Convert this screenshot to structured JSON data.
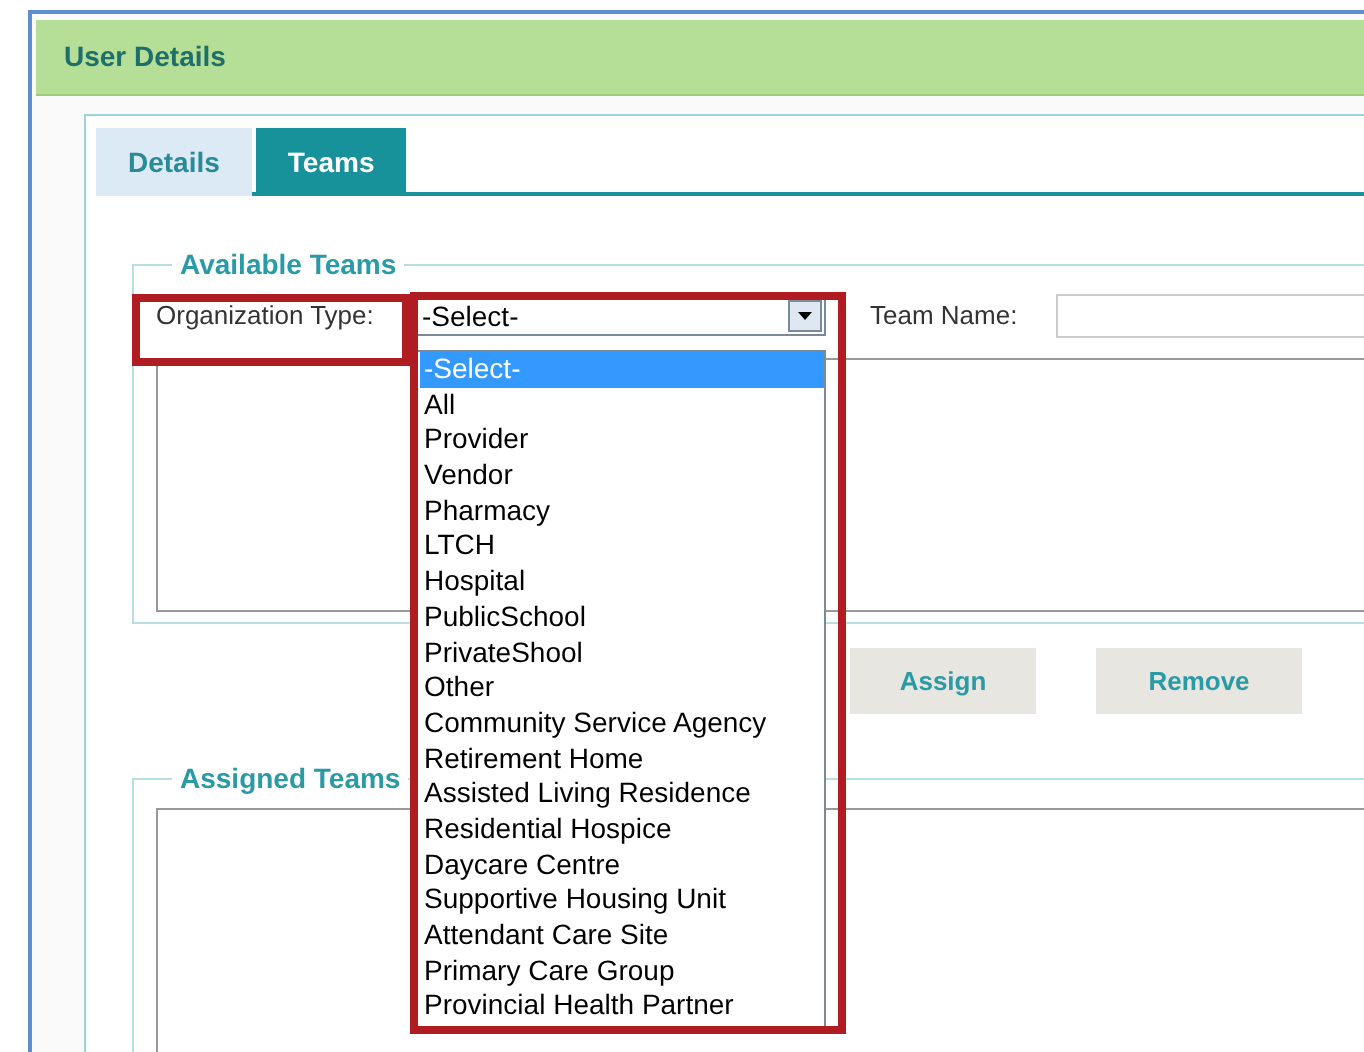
{
  "header": {
    "title": "User Details"
  },
  "tabs": [
    {
      "label": "Details",
      "selected": false
    },
    {
      "label": "Teams",
      "selected": true
    }
  ],
  "available_teams": {
    "legend": "Available Teams",
    "organization_type": {
      "label": "Organization Type:",
      "value": "-Select-",
      "expanded": true,
      "options": [
        {
          "label": "-Select-",
          "selected": true
        },
        {
          "label": "All",
          "selected": false
        },
        {
          "label": "Provider",
          "selected": false
        },
        {
          "label": "Vendor",
          "selected": false
        },
        {
          "label": "Pharmacy",
          "selected": false
        },
        {
          "label": "LTCH",
          "selected": false
        },
        {
          "label": "Hospital",
          "selected": false
        },
        {
          "label": "PublicSchool",
          "selected": false
        },
        {
          "label": "PrivateShool",
          "selected": false
        },
        {
          "label": "Other",
          "selected": false
        },
        {
          "label": "Community Service Agency",
          "selected": false
        },
        {
          "label": "Retirement Home",
          "selected": false
        },
        {
          "label": "Assisted Living Residence",
          "selected": false
        },
        {
          "label": "Residential Hospice",
          "selected": false
        },
        {
          "label": "Daycare Centre",
          "selected": false
        },
        {
          "label": "Supportive Housing Unit",
          "selected": false
        },
        {
          "label": "Attendant Care Site",
          "selected": false
        },
        {
          "label": "Primary Care Group",
          "selected": false
        },
        {
          "label": "Provincial Health Partner",
          "selected": false
        }
      ]
    },
    "team_name": {
      "label": "Team Name:"
    }
  },
  "buttons": [
    "Assign",
    "Remove"
  ],
  "assigned_teams": {
    "legend": "Assigned Teams"
  }
}
